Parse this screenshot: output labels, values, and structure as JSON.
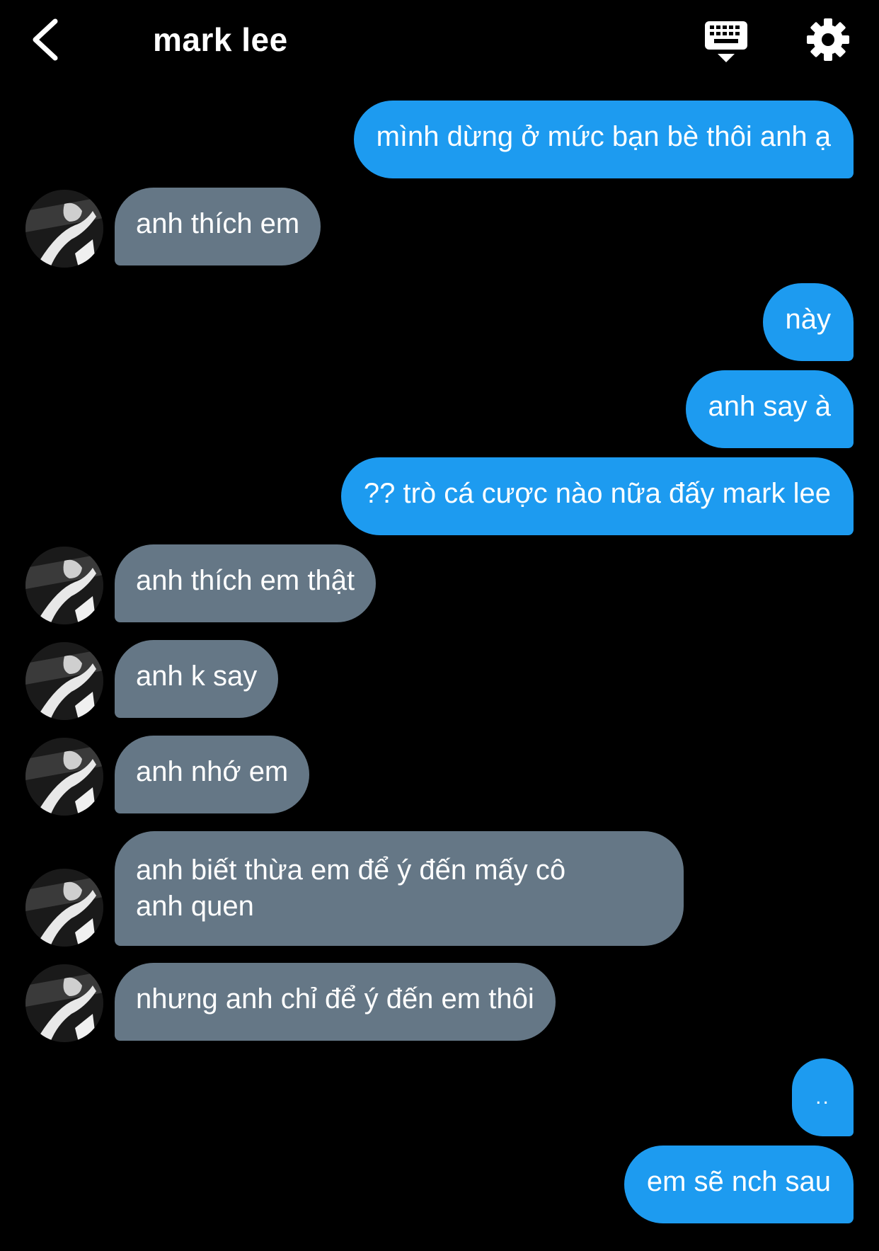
{
  "header": {
    "title": "mark lee",
    "back_icon": "chevron-left-icon",
    "keyboard_icon": "keyboard-icon",
    "settings_icon": "gear-icon"
  },
  "colors": {
    "background": "#000000",
    "sent_bubble": "#1d9bf0",
    "received_bubble": "#657786",
    "text": "#ffffff"
  },
  "messages": [
    {
      "from": "me",
      "text": "mình dừng ở mức bạn bè thôi anh ạ"
    },
    {
      "from": "mark",
      "text": "anh thích em"
    },
    {
      "from": "me",
      "text": "này"
    },
    {
      "from": "me",
      "text": "anh say à"
    },
    {
      "from": "me",
      "text": "?? trò cá cược nào nữa đấy mark lee"
    },
    {
      "from": "mark",
      "text": "anh thích em thật"
    },
    {
      "from": "mark",
      "text": "anh k say"
    },
    {
      "from": "mark",
      "text": "anh nhớ em"
    },
    {
      "from": "mark",
      "text": "anh biết thừa em để ý đến mấy cô",
      "text_line2": "anh quen"
    },
    {
      "from": "mark",
      "text": "nhưng anh chỉ để ý đến em thôi"
    },
    {
      "from": "me",
      "text": ".."
    },
    {
      "from": "me",
      "text": "em sẽ nch sau"
    }
  ]
}
